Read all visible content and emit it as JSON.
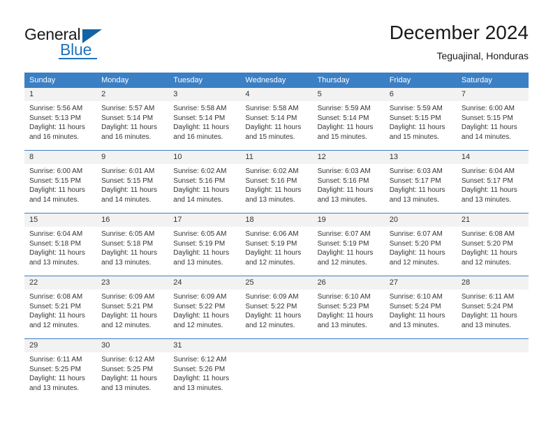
{
  "brand": {
    "name_part1": "General",
    "name_part2": "Blue",
    "triangle_color": "#1464a5",
    "blue_color": "#1f72bd"
  },
  "header": {
    "title": "December 2024",
    "subtitle": "Teguajinal, Honduras"
  },
  "theme": {
    "header_bg": "#3b7fc4",
    "daynum_bg": "#f2f2f2",
    "text_color": "#333333"
  },
  "weekday_headers": [
    "Sunday",
    "Monday",
    "Tuesday",
    "Wednesday",
    "Thursday",
    "Friday",
    "Saturday"
  ],
  "labels": {
    "sunrise_prefix": "Sunrise:",
    "sunset_prefix": "Sunset:",
    "daylight_prefix": "Daylight:"
  },
  "days": [
    {
      "date": "1",
      "sunrise": "Sunrise: 5:56 AM",
      "sunset": "Sunset: 5:13 PM",
      "daylight": "Daylight: 11 hours and 16 minutes."
    },
    {
      "date": "2",
      "sunrise": "Sunrise: 5:57 AM",
      "sunset": "Sunset: 5:14 PM",
      "daylight": "Daylight: 11 hours and 16 minutes."
    },
    {
      "date": "3",
      "sunrise": "Sunrise: 5:58 AM",
      "sunset": "Sunset: 5:14 PM",
      "daylight": "Daylight: 11 hours and 16 minutes."
    },
    {
      "date": "4",
      "sunrise": "Sunrise: 5:58 AM",
      "sunset": "Sunset: 5:14 PM",
      "daylight": "Daylight: 11 hours and 15 minutes."
    },
    {
      "date": "5",
      "sunrise": "Sunrise: 5:59 AM",
      "sunset": "Sunset: 5:14 PM",
      "daylight": "Daylight: 11 hours and 15 minutes."
    },
    {
      "date": "6",
      "sunrise": "Sunrise: 5:59 AM",
      "sunset": "Sunset: 5:15 PM",
      "daylight": "Daylight: 11 hours and 15 minutes."
    },
    {
      "date": "7",
      "sunrise": "Sunrise: 6:00 AM",
      "sunset": "Sunset: 5:15 PM",
      "daylight": "Daylight: 11 hours and 14 minutes."
    },
    {
      "date": "8",
      "sunrise": "Sunrise: 6:00 AM",
      "sunset": "Sunset: 5:15 PM",
      "daylight": "Daylight: 11 hours and 14 minutes."
    },
    {
      "date": "9",
      "sunrise": "Sunrise: 6:01 AM",
      "sunset": "Sunset: 5:15 PM",
      "daylight": "Daylight: 11 hours and 14 minutes."
    },
    {
      "date": "10",
      "sunrise": "Sunrise: 6:02 AM",
      "sunset": "Sunset: 5:16 PM",
      "daylight": "Daylight: 11 hours and 14 minutes."
    },
    {
      "date": "11",
      "sunrise": "Sunrise: 6:02 AM",
      "sunset": "Sunset: 5:16 PM",
      "daylight": "Daylight: 11 hours and 13 minutes."
    },
    {
      "date": "12",
      "sunrise": "Sunrise: 6:03 AM",
      "sunset": "Sunset: 5:16 PM",
      "daylight": "Daylight: 11 hours and 13 minutes."
    },
    {
      "date": "13",
      "sunrise": "Sunrise: 6:03 AM",
      "sunset": "Sunset: 5:17 PM",
      "daylight": "Daylight: 11 hours and 13 minutes."
    },
    {
      "date": "14",
      "sunrise": "Sunrise: 6:04 AM",
      "sunset": "Sunset: 5:17 PM",
      "daylight": "Daylight: 11 hours and 13 minutes."
    },
    {
      "date": "15",
      "sunrise": "Sunrise: 6:04 AM",
      "sunset": "Sunset: 5:18 PM",
      "daylight": "Daylight: 11 hours and 13 minutes."
    },
    {
      "date": "16",
      "sunrise": "Sunrise: 6:05 AM",
      "sunset": "Sunset: 5:18 PM",
      "daylight": "Daylight: 11 hours and 13 minutes."
    },
    {
      "date": "17",
      "sunrise": "Sunrise: 6:05 AM",
      "sunset": "Sunset: 5:19 PM",
      "daylight": "Daylight: 11 hours and 13 minutes."
    },
    {
      "date": "18",
      "sunrise": "Sunrise: 6:06 AM",
      "sunset": "Sunset: 5:19 PM",
      "daylight": "Daylight: 11 hours and 12 minutes."
    },
    {
      "date": "19",
      "sunrise": "Sunrise: 6:07 AM",
      "sunset": "Sunset: 5:19 PM",
      "daylight": "Daylight: 11 hours and 12 minutes."
    },
    {
      "date": "20",
      "sunrise": "Sunrise: 6:07 AM",
      "sunset": "Sunset: 5:20 PM",
      "daylight": "Daylight: 11 hours and 12 minutes."
    },
    {
      "date": "21",
      "sunrise": "Sunrise: 6:08 AM",
      "sunset": "Sunset: 5:20 PM",
      "daylight": "Daylight: 11 hours and 12 minutes."
    },
    {
      "date": "22",
      "sunrise": "Sunrise: 6:08 AM",
      "sunset": "Sunset: 5:21 PM",
      "daylight": "Daylight: 11 hours and 12 minutes."
    },
    {
      "date": "23",
      "sunrise": "Sunrise: 6:09 AM",
      "sunset": "Sunset: 5:21 PM",
      "daylight": "Daylight: 11 hours and 12 minutes."
    },
    {
      "date": "24",
      "sunrise": "Sunrise: 6:09 AM",
      "sunset": "Sunset: 5:22 PM",
      "daylight": "Daylight: 11 hours and 12 minutes."
    },
    {
      "date": "25",
      "sunrise": "Sunrise: 6:09 AM",
      "sunset": "Sunset: 5:22 PM",
      "daylight": "Daylight: 11 hours and 12 minutes."
    },
    {
      "date": "26",
      "sunrise": "Sunrise: 6:10 AM",
      "sunset": "Sunset: 5:23 PM",
      "daylight": "Daylight: 11 hours and 13 minutes."
    },
    {
      "date": "27",
      "sunrise": "Sunrise: 6:10 AM",
      "sunset": "Sunset: 5:24 PM",
      "daylight": "Daylight: 11 hours and 13 minutes."
    },
    {
      "date": "28",
      "sunrise": "Sunrise: 6:11 AM",
      "sunset": "Sunset: 5:24 PM",
      "daylight": "Daylight: 11 hours and 13 minutes."
    },
    {
      "date": "29",
      "sunrise": "Sunrise: 6:11 AM",
      "sunset": "Sunset: 5:25 PM",
      "daylight": "Daylight: 11 hours and 13 minutes."
    },
    {
      "date": "30",
      "sunrise": "Sunrise: 6:12 AM",
      "sunset": "Sunset: 5:25 PM",
      "daylight": "Daylight: 11 hours and 13 minutes."
    },
    {
      "date": "31",
      "sunrise": "Sunrise: 6:12 AM",
      "sunset": "Sunset: 5:26 PM",
      "daylight": "Daylight: 11 hours and 13 minutes."
    }
  ],
  "grid": {
    "leading_blanks": 0,
    "trailing_blanks": 4
  }
}
